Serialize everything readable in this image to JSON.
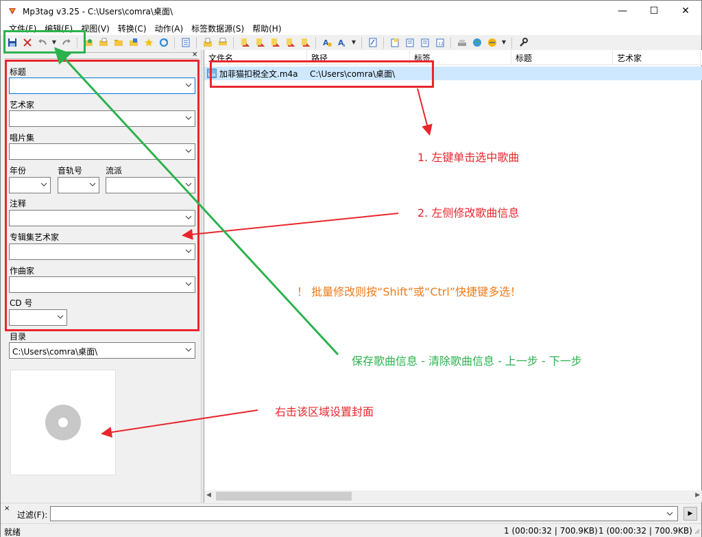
{
  "window": {
    "title": "Mp3tag v3.25  -  C:\\Users\\comra\\桌面\\",
    "minimize": "—",
    "maximize": "☐",
    "close": "✕"
  },
  "menu": [
    "文件(F)",
    "编辑(E)",
    "视图(V)",
    "转换(C)",
    "动作(A)",
    "标签数据源(S)",
    "帮助(H)"
  ],
  "toolbar": {
    "icons": [
      "save-icon",
      "remove-tag-icon",
      "undo-icon",
      "undo-dropdown-icon",
      "redo-icon",
      "change-dir-icon",
      "add-dir-icon",
      "open-folder-icon",
      "folder-up-icon",
      "favorites-icon",
      "refresh-icon",
      "playlist-icon",
      "export-icon",
      "print-icon",
      "tag-to-filename-icon",
      "filename-to-tag-icon",
      "text-to-tag-icon",
      "tag-to-tag-icon",
      "actions-icon",
      "action-dropdown-icon",
      "autonumber-icon",
      "extended-tags-icon",
      "case-conversion-icon",
      "auto-numbering-wizard-icon",
      "tag-sources-icon",
      "freedb-icon",
      "web-sources-icon",
      "web-dropdown-icon",
      "settings-icon"
    ]
  },
  "tag_panel": {
    "close": "×",
    "fields": {
      "title": {
        "label": "标题",
        "value": ""
      },
      "artist": {
        "label": "艺术家",
        "value": ""
      },
      "album": {
        "label": "唱片集",
        "value": ""
      },
      "year": {
        "label": "年份",
        "value": ""
      },
      "track": {
        "label": "音轨号",
        "value": ""
      },
      "genre": {
        "label": "流派",
        "value": ""
      },
      "comment": {
        "label": "注释",
        "value": ""
      },
      "album_artist": {
        "label": "专辑集艺术家",
        "value": ""
      },
      "composer": {
        "label": "作曲家",
        "value": ""
      },
      "disc": {
        "label": "CD 号",
        "value": ""
      },
      "directory": {
        "label": "目录",
        "value": "C:\\Users\\comra\\桌面\\"
      }
    }
  },
  "file_list": {
    "columns": [
      "文件名",
      "路径",
      "标签",
      "标题",
      "艺术家"
    ],
    "rows": [
      {
        "filename": "加菲猫扣税全文.m4a",
        "path": "C:\\Users\\comra\\桌面\\",
        "icon_text": "M4A"
      }
    ]
  },
  "filter": {
    "label": "过滤(F):",
    "value": "",
    "close": "×",
    "go": "▶"
  },
  "status": {
    "left": "就绪",
    "selected": "1 (00:00:32 | 700.9KB)",
    "total": "1 (00:00:32 | 700.9KB)"
  },
  "annotations": {
    "step1": "1. 左键单击选中歌曲",
    "step2": "2. 左侧修改歌曲信息",
    "note": "！ 批量修改则按“Shift”或“Ctrl”快捷键多选！",
    "toolbar_hint": "保存歌曲信息 - 清除歌曲信息 - 上一步 - 下一步",
    "cover_hint": "右击该区域设置封面",
    "colors": {
      "red": "#e8262c",
      "green": "#2bb24c",
      "orange": "#f07a18"
    }
  }
}
